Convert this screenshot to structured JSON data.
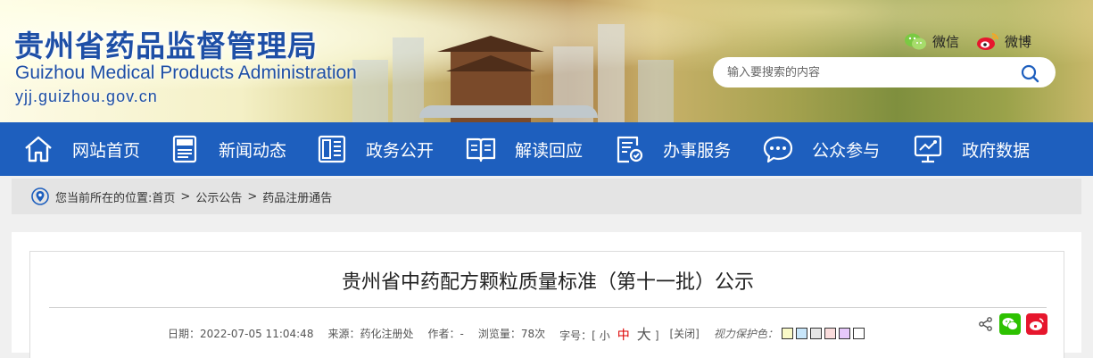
{
  "header": {
    "title": "贵州省药品监督管理局",
    "title_en": "Guizhou Medical Products Administration",
    "url": "yjj.guizhou.gov.cn",
    "social": [
      {
        "label": "微信",
        "icon": "wechat-icon"
      },
      {
        "label": "微博",
        "icon": "weibo-icon"
      }
    ],
    "search_placeholder": "输入要搜索的内容"
  },
  "nav": {
    "items": [
      {
        "label": "网站首页",
        "icon": "home-icon"
      },
      {
        "label": "新闻动态",
        "icon": "news-icon"
      },
      {
        "label": "政务公开",
        "icon": "document-icon"
      },
      {
        "label": "解读回应",
        "icon": "book-icon"
      },
      {
        "label": "办事服务",
        "icon": "service-form-icon"
      },
      {
        "label": "公众参与",
        "icon": "chat-bubble-icon"
      },
      {
        "label": "政府数据",
        "icon": "data-screen-icon"
      }
    ]
  },
  "breadcrumb": {
    "prefix": "您当前所在的位置: ",
    "items": [
      "首页",
      "公示公告",
      "药品注册通告"
    ],
    "separator": ">"
  },
  "article": {
    "title": "贵州省中药配方颗粒质量标准（第十一批）公示",
    "meta": {
      "date": "日期：2022-07-05 11:04:48",
      "source": "来源：药化注册处",
      "author": "作者：-",
      "views": "浏览量：78次",
      "font_size_label": "字号：[",
      "font_small": "小",
      "font_medium": "中",
      "font_large": "大",
      "font_close_bracket": "]",
      "close": "[关闭]",
      "eye_care_label": "视力保护色："
    },
    "eye_care_colors": [
      "#fafac8",
      "#c8e6fa",
      "#e6e6e6",
      "#fadcdc",
      "#e6c8fa",
      "#ffffff"
    ]
  },
  "colors": {
    "nav_bg": "#1e5fbe",
    "title_blue": "#1e4fa6",
    "font_medium_red": "#dd0000",
    "wechat_green": "#2dc100",
    "weibo_red": "#e6162d"
  }
}
